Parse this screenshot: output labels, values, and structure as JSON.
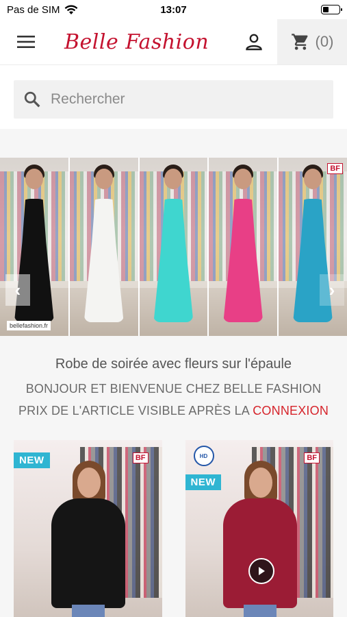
{
  "status_bar": {
    "carrier": "Pas de SIM",
    "time": "13:07",
    "battery_level": 0.35
  },
  "header": {
    "logo_text": "Belle Fashion",
    "cart_count": "(0)",
    "menu_icon": "hamburger-menu-icon",
    "account_icon": "user-icon",
    "cart_icon": "shopping-cart-icon"
  },
  "search": {
    "placeholder": "Rechercher",
    "icon": "search-icon"
  },
  "carousel": {
    "slides": [
      {
        "dress_color": "#111111"
      },
      {
        "dress_color": "#f4f4f2"
      },
      {
        "dress_color": "#3fd6cf"
      },
      {
        "dress_color": "#e83f86"
      },
      {
        "dress_color": "#2aa3c6"
      }
    ],
    "badge": "BF",
    "watermark": "bellefashion.fr"
  },
  "main": {
    "product_title": "Robe de soirée avec fleurs sur l'épaule",
    "welcome_line_1": "BONJOUR ET BIENVENUE CHEZ BELLE FASHION",
    "price_notice": "PRIX DE L'ARTICLE VISIBLE APRÈS LA ",
    "connexion_link": "CONNEXION"
  },
  "products": [
    {
      "badge": "NEW",
      "brand_badge": "BF",
      "shirt_color": "#151515"
    },
    {
      "badge": "NEW",
      "brand_badge": "BF",
      "hd_badge": "HD",
      "shirt_color": "#9b1c35"
    }
  ],
  "colors": {
    "brand_red": "#c4122f",
    "accent_blue": "#2fb5d2",
    "link_red": "#d6242b"
  }
}
